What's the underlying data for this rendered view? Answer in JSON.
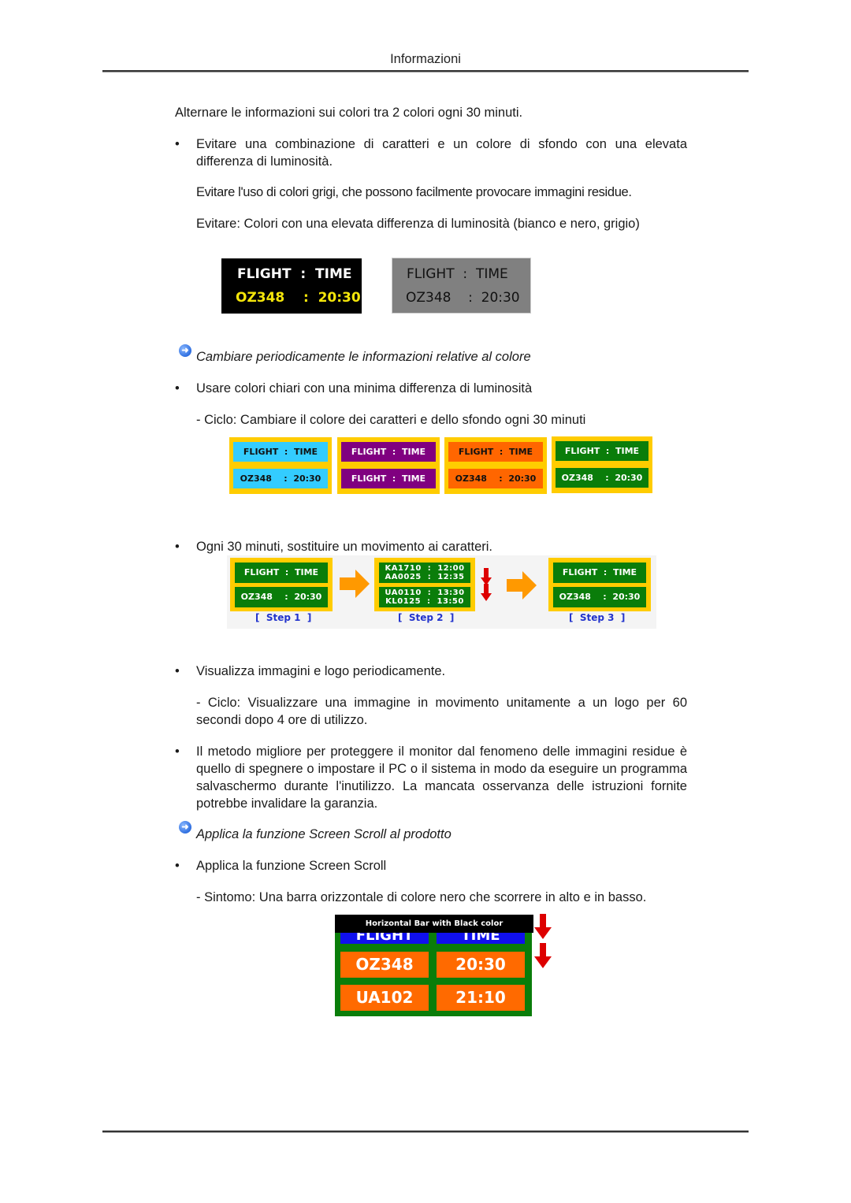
{
  "header": {
    "title": "Informazioni"
  },
  "paragraphs": {
    "intro": "Alternare le informazioni sui colori tra 2 colori ogni 30 minuti.",
    "bullet1": "Evitare una combinazione di caratteri e un colore di sfondo con una elevata differenza di luminosità.",
    "bullet1_sub1": "Evitare l'uso di colori grigi, che possono facilmente provocare immagini residue.",
    "bullet1_sub2": "Evitare: Colori con una elevata differenza di luminosità (bianco e nero, grigio)",
    "note1": "Cambiare periodicamente le informazioni relative al colore",
    "bullet2": "Usare colori chiari con una minima differenza di luminosità",
    "bullet2_sub": "- Ciclo: Cambiare il colore dei caratteri e dello sfondo ogni 30 minuti",
    "bullet3": "Ogni 30 minuti, sostituire un movimento ai caratteri.",
    "bullet4": "Visualizza immagini e logo periodicamente.",
    "bullet4_sub": "- Ciclo: Visualizzare una immagine in movimento unitamente a un logo per 60 secondi dopo 4 ore di utilizzo.",
    "bullet5": "Il metodo migliore per proteggere il monitor dal fenomeno delle immagini residue è quello di spegnere o impostare il PC o il sistema in modo da eseguire un programma salvaschermo durante l'inutilizzo. La mancata osservanza delle istruzioni fornite potrebbe invalidare la garanzia.",
    "note2": "Applica la funzione Screen Scroll al prodotto",
    "bullet6": "Applica la funzione Screen Scroll",
    "bullet6_sub": "- Sintomo: Una barra orizzontale di colore nero che scorrere in alto e in basso."
  },
  "bullet_char": "•",
  "icons": {
    "note_icon": "➜"
  },
  "contrast_examples": [
    {
      "row1": "FLIGHT  :  TIME",
      "row2": "OZ348    :  20:30",
      "bg": "#000000",
      "fg1": "#ffffff",
      "fg2": "#f5e60a"
    },
    {
      "row1": "FLIGHT  :  TIME",
      "row2": "OZ348    :  20:30",
      "bg": "#808080",
      "fg1": "#111111",
      "fg2": "#111111"
    }
  ],
  "color_cycle": [
    {
      "top": "FLIGHT  :  TIME",
      "bottom": "OZ348    :  20:30",
      "bg": "#33ccff",
      "fg": "#111111"
    },
    {
      "top": "FLIGHT  :  TIME",
      "bottom": "FLIGHT  :  TIME",
      "bg": "#800080",
      "fg": "#ffffff"
    },
    {
      "top": "FLIGHT  :  TIME",
      "bottom": "OZ348    :  20:30",
      "bg": "#ff6600",
      "fg": "#111111"
    },
    {
      "top": "FLIGHT  :  TIME",
      "bottom": "OZ348    :  20:30",
      "bg": "#0a7d0a",
      "fg": "#ffffff"
    }
  ],
  "steps": [
    {
      "label": "[  Step 1  ]",
      "top": "FLIGHT  :  TIME",
      "bottom": "OZ348    :  20:30"
    },
    {
      "label": "[  Step 2  ]",
      "top": "KA1710  :  12:00\nAA0025  :  12:35",
      "bottom": "UA0110  :  13:30\nKL0125  :  13:50"
    },
    {
      "label": "[  Step 3  ]",
      "top": "FLIGHT  :  TIME",
      "bottom": "OZ348    :  20:30"
    }
  ],
  "scroll_demo": {
    "bar_label": "Horizontal Bar with Black color",
    "header": [
      "FLIGHT",
      "TIME"
    ],
    "rows": [
      [
        "OZ348",
        "20:30"
      ],
      [
        "UA102",
        "21:10"
      ]
    ]
  },
  "colors": {
    "accent_yellow": "#ffcc00",
    "green": "#0a7d0a",
    "orange": "#ff6a00",
    "step_blue": "#2233cc",
    "arrow_orange": "#ff9900",
    "arrow_red": "#dd0000"
  }
}
